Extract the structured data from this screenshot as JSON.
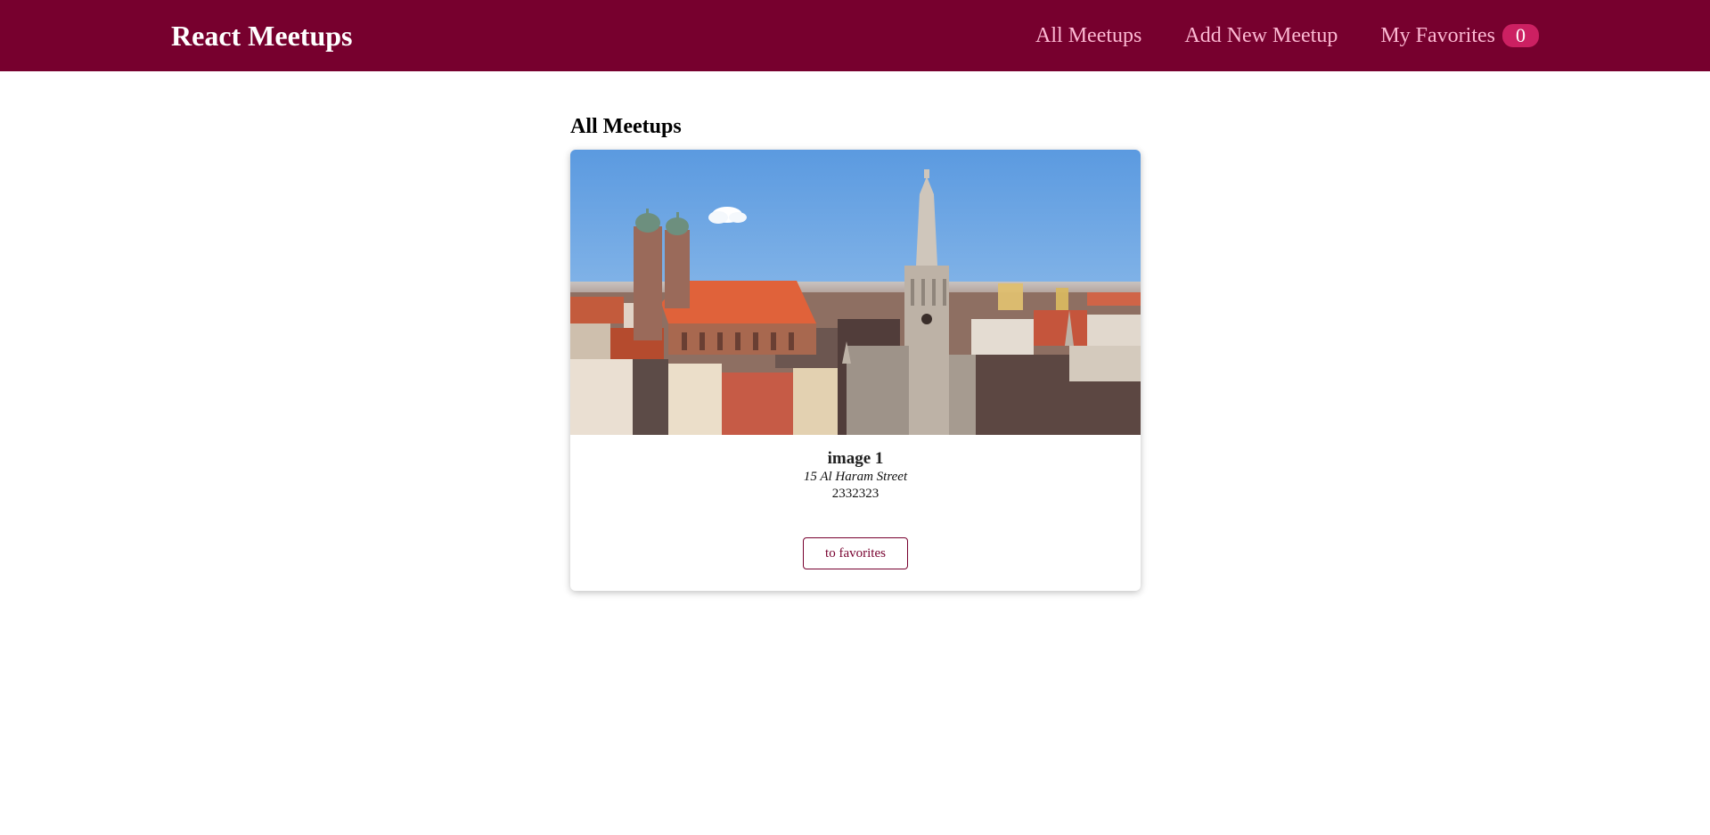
{
  "header": {
    "logo": "React Meetups",
    "nav": {
      "all_meetups": "All Meetups",
      "add_meetup": "Add New Meetup",
      "favorites": "My Favorites",
      "favorites_count": "0"
    }
  },
  "main": {
    "title": "All Meetups",
    "meetups": [
      {
        "image_icon": "munich-cityscape-photo",
        "title": "image 1",
        "address": "15 Al Haram Street",
        "description": "2332323",
        "button_label": "to favorites"
      }
    ]
  },
  "colors": {
    "brand": "#77002e",
    "nav_link": "#fcb8d2",
    "badge": "#cc2062",
    "button_border": "#77002e"
  }
}
